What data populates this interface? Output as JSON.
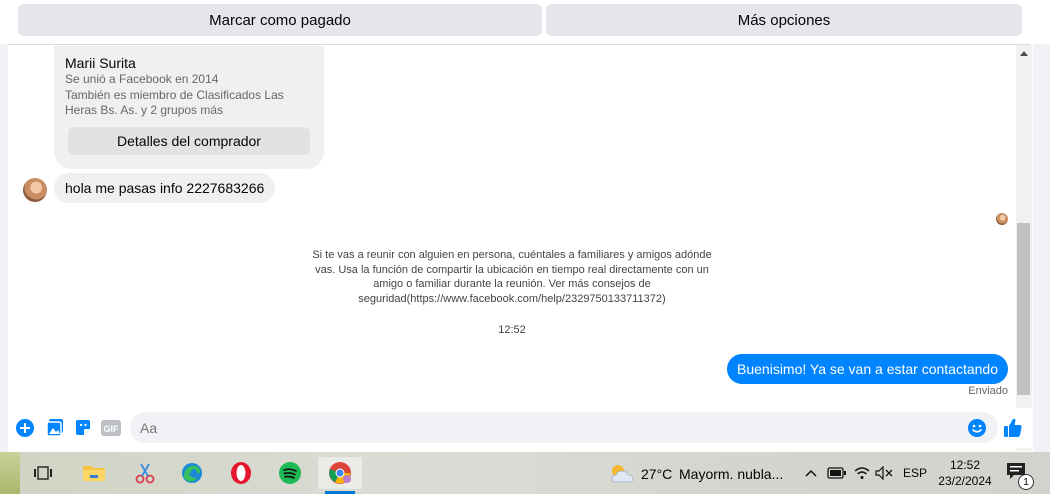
{
  "topbar": {
    "mark_paid_label": "Marcar como pagado",
    "more_options_label": "Más opciones"
  },
  "buyer": {
    "name": "Marii Surita",
    "joined": "Se unió a Facebook en 2014",
    "groups": "También es miembro de Clasificados Las Heras Bs. As. y 2 grupos más",
    "details_button": "Detalles del comprador"
  },
  "messages": {
    "incoming": "hola me pasas info 2227683266",
    "safety_notice": "Si te vas a reunir con alguien en persona, cuéntales a familiares y amigos adónde vas. Usa la función de compartir la ubicación en tiempo real directamente con un amigo o familiar durante la reunión. Ver más consejos de seguridad(https://www.facebook.com/help/2329750133711372)",
    "timestamp": "12:52",
    "outgoing": "Buenisimo! Ya se van a estar contactando",
    "status": "Enviado"
  },
  "composer": {
    "placeholder": "Aa",
    "gif_label": "GIF"
  },
  "taskbar": {
    "temperature": "27°C",
    "condition": "Mayorm. nubla...",
    "language": "ESP",
    "time": "12:52",
    "date": "23/2/2024",
    "notification_count": "1"
  },
  "colors": {
    "accent": "#0084ff",
    "bubble_gray": "#f0f0f0",
    "button_gray": "#e4e6eb"
  },
  "icons": [
    "plus-circle-icon",
    "photo-icon",
    "sticker-icon",
    "gif-icon",
    "emoji-icon",
    "thumbs-up-icon",
    "task-view-icon",
    "file-explorer-icon",
    "snipping-tool-icon",
    "edge-icon",
    "opera-icon",
    "spotify-icon",
    "chrome-icon",
    "weather-icon",
    "chevron-up-icon",
    "battery-icon",
    "wifi-icon",
    "volume-muted-icon",
    "notification-icon"
  ]
}
